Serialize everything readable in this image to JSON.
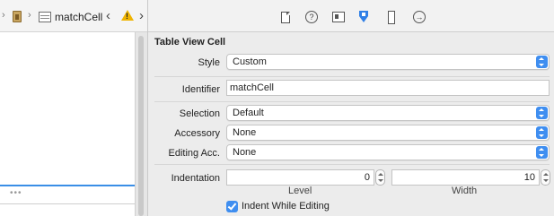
{
  "jumpbar": {
    "cell_name": "matchCell",
    "back_glyph": "‹",
    "forward_glyph": "›",
    "separator_glyph": "›",
    "warning_glyph": "!"
  },
  "left_pane": {
    "dots": "•••"
  },
  "inspector": {
    "toolbar_icons": [
      "file-inspector-icon",
      "quick-help-icon",
      "identity-inspector-icon",
      "attributes-inspector-icon",
      "size-inspector-icon",
      "connections-inspector-icon"
    ],
    "help_glyph": "?",
    "connections_glyph": "→",
    "section_title": "Table View Cell",
    "style": {
      "label": "Style",
      "value": "Custom"
    },
    "identifier": {
      "label": "Identifier",
      "value": "matchCell"
    },
    "selection": {
      "label": "Selection",
      "value": "Default"
    },
    "accessory": {
      "label": "Accessory",
      "value": "None"
    },
    "editing_acc": {
      "label": "Editing Acc.",
      "value": "None"
    },
    "indentation": {
      "label": "Indentation",
      "level_value": "0",
      "level_label": "Level",
      "width_value": "10",
      "width_label": "Width"
    },
    "indent_while_editing": {
      "label": "Indent While Editing",
      "checked": true
    },
    "accent_color": "#3f8ef0"
  }
}
